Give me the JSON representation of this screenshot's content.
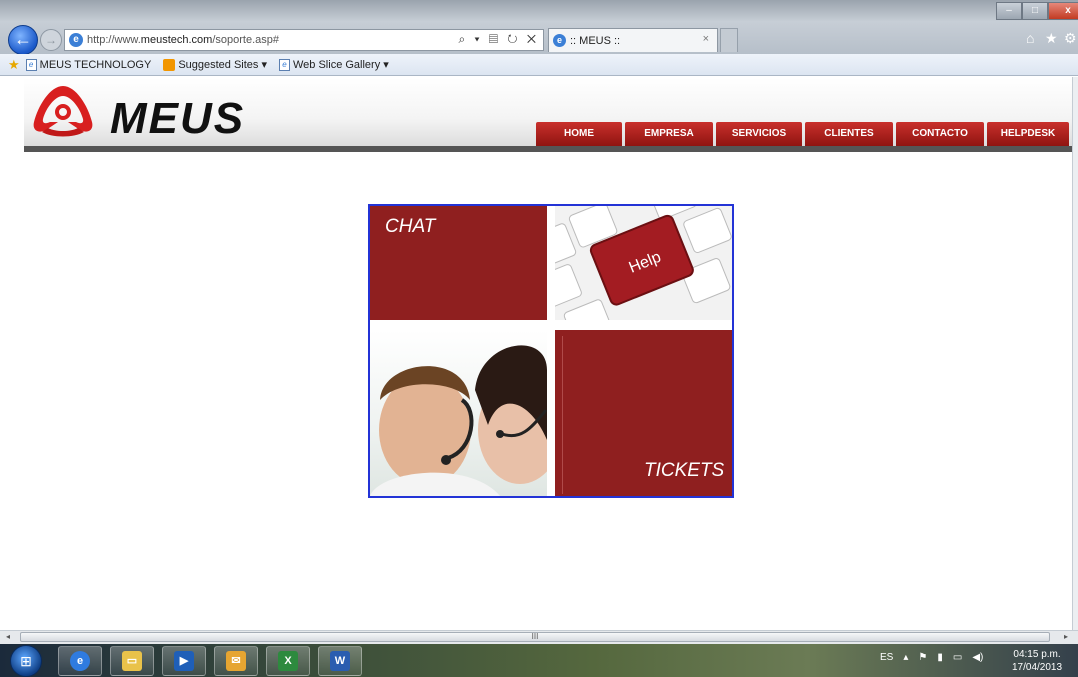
{
  "browser": {
    "url": "http://www.meustech.com/soporte.asp#",
    "url_prefix": "http://www.",
    "url_domain": "meustech.com",
    "url_path": "/soporte.asp#",
    "address_tools": "⌕ ▾ ▤ ↻ ✕",
    "tab_title": ":: MEUS ::",
    "tab_close": "×",
    "window_controls": {
      "min": "–",
      "max": "□",
      "close": "x"
    }
  },
  "favorites": {
    "items": [
      {
        "label": "MEUS TECHNOLOGY"
      },
      {
        "label": "Suggested Sites ▾"
      },
      {
        "label": "Web Slice Gallery ▾"
      }
    ]
  },
  "site": {
    "logo_text": "MEUS",
    "nav": [
      {
        "label": "HOME"
      },
      {
        "label": "EMPRESA"
      },
      {
        "label": "SERVICIOS"
      },
      {
        "label": "CLIENTES"
      },
      {
        "label": "CONTACTO"
      },
      {
        "label": "HELPDESK"
      }
    ],
    "accent": "#8f1f1f",
    "nav_color": "#b0201c"
  },
  "helpbox": {
    "chat_label": "CHAT",
    "key_label": "Help",
    "tickets_label": "TICKETS",
    "border_color": "#2333d6"
  },
  "scrollbar": {
    "grip": "III"
  },
  "taskbar": {
    "apps": [
      {
        "name": "internet-explorer"
      },
      {
        "name": "file-explorer"
      },
      {
        "name": "media-player"
      },
      {
        "name": "outlook"
      },
      {
        "name": "excel"
      },
      {
        "name": "word"
      }
    ],
    "language": "ES",
    "time": "04:15 p.m.",
    "date": "17/04/2013"
  }
}
